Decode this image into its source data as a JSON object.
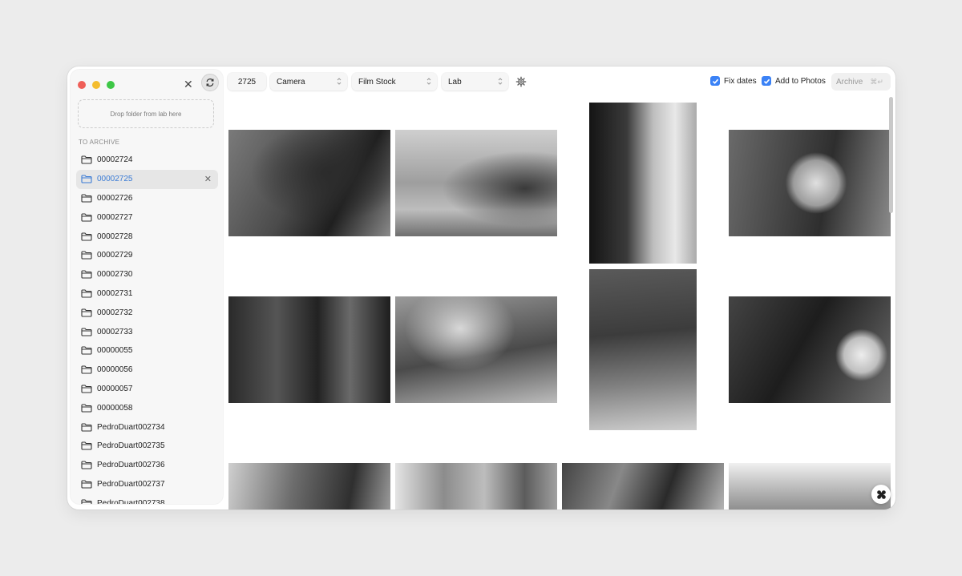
{
  "sidebar": {
    "dropzone_text": "Drop folder from lab here",
    "section_label": "TO ARCHIVE",
    "folders": [
      {
        "name": "00002724",
        "selected": false
      },
      {
        "name": "00002725",
        "selected": true
      },
      {
        "name": "00002726",
        "selected": false
      },
      {
        "name": "00002727",
        "selected": false
      },
      {
        "name": "00002728",
        "selected": false
      },
      {
        "name": "00002729",
        "selected": false
      },
      {
        "name": "00002730",
        "selected": false
      },
      {
        "name": "00002731",
        "selected": false
      },
      {
        "name": "00002732",
        "selected": false
      },
      {
        "name": "00002733",
        "selected": false
      },
      {
        "name": "00000055",
        "selected": false
      },
      {
        "name": "00000056",
        "selected": false
      },
      {
        "name": "00000057",
        "selected": false
      },
      {
        "name": "00000058",
        "selected": false
      },
      {
        "name": "PedroDuart002734",
        "selected": false
      },
      {
        "name": "PedroDuart002735",
        "selected": false
      },
      {
        "name": "PedroDuart002736",
        "selected": false
      },
      {
        "name": "PedroDuart002737",
        "selected": false
      },
      {
        "name": "PedroDuart002738",
        "selected": false
      }
    ]
  },
  "toolbar": {
    "roll_number": "2725",
    "camera_label": "Camera",
    "film_stock_label": "Film Stock",
    "lab_label": "Lab",
    "fix_dates_label": "Fix dates",
    "fix_dates_checked": true,
    "add_to_photos_label": "Add to Photos",
    "add_to_photos_checked": true,
    "archive_label": "Archive",
    "archive_shortcut": "⌘↵"
  },
  "colors": {
    "accent": "#3b82f6",
    "selected_text": "#3a7bd5",
    "traffic_red": "#ef5f58",
    "traffic_yellow": "#f4bd2f",
    "traffic_green": "#3ec746"
  },
  "photos": [
    {
      "id": "photo-1",
      "orientation": "landscape"
    },
    {
      "id": "photo-2",
      "orientation": "landscape"
    },
    {
      "id": "photo-3",
      "orientation": "portrait"
    },
    {
      "id": "photo-4",
      "orientation": "landscape"
    },
    {
      "id": "photo-5",
      "orientation": "landscape"
    },
    {
      "id": "photo-6",
      "orientation": "landscape"
    },
    {
      "id": "photo-7",
      "orientation": "portrait"
    },
    {
      "id": "photo-8",
      "orientation": "landscape"
    },
    {
      "id": "photo-9",
      "orientation": "landscape"
    },
    {
      "id": "photo-10",
      "orientation": "landscape"
    },
    {
      "id": "photo-11",
      "orientation": "landscape"
    },
    {
      "id": "photo-12",
      "orientation": "landscape"
    }
  ]
}
